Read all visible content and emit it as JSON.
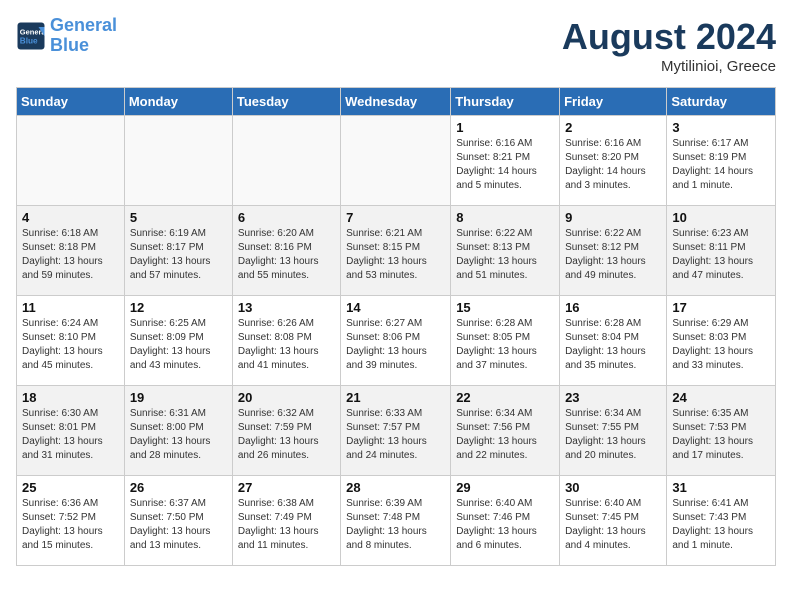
{
  "logo": {
    "line1": "General",
    "line2": "Blue"
  },
  "title": "August 2024",
  "subtitle": "Mytilinioi, Greece",
  "weekdays": [
    "Sunday",
    "Monday",
    "Tuesday",
    "Wednesday",
    "Thursday",
    "Friday",
    "Saturday"
  ],
  "weeks": [
    [
      {
        "day": "",
        "info": ""
      },
      {
        "day": "",
        "info": ""
      },
      {
        "day": "",
        "info": ""
      },
      {
        "day": "",
        "info": ""
      },
      {
        "day": "1",
        "info": "Sunrise: 6:16 AM\nSunset: 8:21 PM\nDaylight: 14 hours\nand 5 minutes."
      },
      {
        "day": "2",
        "info": "Sunrise: 6:16 AM\nSunset: 8:20 PM\nDaylight: 14 hours\nand 3 minutes."
      },
      {
        "day": "3",
        "info": "Sunrise: 6:17 AM\nSunset: 8:19 PM\nDaylight: 14 hours\nand 1 minute."
      }
    ],
    [
      {
        "day": "4",
        "info": "Sunrise: 6:18 AM\nSunset: 8:18 PM\nDaylight: 13 hours\nand 59 minutes."
      },
      {
        "day": "5",
        "info": "Sunrise: 6:19 AM\nSunset: 8:17 PM\nDaylight: 13 hours\nand 57 minutes."
      },
      {
        "day": "6",
        "info": "Sunrise: 6:20 AM\nSunset: 8:16 PM\nDaylight: 13 hours\nand 55 minutes."
      },
      {
        "day": "7",
        "info": "Sunrise: 6:21 AM\nSunset: 8:15 PM\nDaylight: 13 hours\nand 53 minutes."
      },
      {
        "day": "8",
        "info": "Sunrise: 6:22 AM\nSunset: 8:13 PM\nDaylight: 13 hours\nand 51 minutes."
      },
      {
        "day": "9",
        "info": "Sunrise: 6:22 AM\nSunset: 8:12 PM\nDaylight: 13 hours\nand 49 minutes."
      },
      {
        "day": "10",
        "info": "Sunrise: 6:23 AM\nSunset: 8:11 PM\nDaylight: 13 hours\nand 47 minutes."
      }
    ],
    [
      {
        "day": "11",
        "info": "Sunrise: 6:24 AM\nSunset: 8:10 PM\nDaylight: 13 hours\nand 45 minutes."
      },
      {
        "day": "12",
        "info": "Sunrise: 6:25 AM\nSunset: 8:09 PM\nDaylight: 13 hours\nand 43 minutes."
      },
      {
        "day": "13",
        "info": "Sunrise: 6:26 AM\nSunset: 8:08 PM\nDaylight: 13 hours\nand 41 minutes."
      },
      {
        "day": "14",
        "info": "Sunrise: 6:27 AM\nSunset: 8:06 PM\nDaylight: 13 hours\nand 39 minutes."
      },
      {
        "day": "15",
        "info": "Sunrise: 6:28 AM\nSunset: 8:05 PM\nDaylight: 13 hours\nand 37 minutes."
      },
      {
        "day": "16",
        "info": "Sunrise: 6:28 AM\nSunset: 8:04 PM\nDaylight: 13 hours\nand 35 minutes."
      },
      {
        "day": "17",
        "info": "Sunrise: 6:29 AM\nSunset: 8:03 PM\nDaylight: 13 hours\nand 33 minutes."
      }
    ],
    [
      {
        "day": "18",
        "info": "Sunrise: 6:30 AM\nSunset: 8:01 PM\nDaylight: 13 hours\nand 31 minutes."
      },
      {
        "day": "19",
        "info": "Sunrise: 6:31 AM\nSunset: 8:00 PM\nDaylight: 13 hours\nand 28 minutes."
      },
      {
        "day": "20",
        "info": "Sunrise: 6:32 AM\nSunset: 7:59 PM\nDaylight: 13 hours\nand 26 minutes."
      },
      {
        "day": "21",
        "info": "Sunrise: 6:33 AM\nSunset: 7:57 PM\nDaylight: 13 hours\nand 24 minutes."
      },
      {
        "day": "22",
        "info": "Sunrise: 6:34 AM\nSunset: 7:56 PM\nDaylight: 13 hours\nand 22 minutes."
      },
      {
        "day": "23",
        "info": "Sunrise: 6:34 AM\nSunset: 7:55 PM\nDaylight: 13 hours\nand 20 minutes."
      },
      {
        "day": "24",
        "info": "Sunrise: 6:35 AM\nSunset: 7:53 PM\nDaylight: 13 hours\nand 17 minutes."
      }
    ],
    [
      {
        "day": "25",
        "info": "Sunrise: 6:36 AM\nSunset: 7:52 PM\nDaylight: 13 hours\nand 15 minutes."
      },
      {
        "day": "26",
        "info": "Sunrise: 6:37 AM\nSunset: 7:50 PM\nDaylight: 13 hours\nand 13 minutes."
      },
      {
        "day": "27",
        "info": "Sunrise: 6:38 AM\nSunset: 7:49 PM\nDaylight: 13 hours\nand 11 minutes."
      },
      {
        "day": "28",
        "info": "Sunrise: 6:39 AM\nSunset: 7:48 PM\nDaylight: 13 hours\nand 8 minutes."
      },
      {
        "day": "29",
        "info": "Sunrise: 6:40 AM\nSunset: 7:46 PM\nDaylight: 13 hours\nand 6 minutes."
      },
      {
        "day": "30",
        "info": "Sunrise: 6:40 AM\nSunset: 7:45 PM\nDaylight: 13 hours\nand 4 minutes."
      },
      {
        "day": "31",
        "info": "Sunrise: 6:41 AM\nSunset: 7:43 PM\nDaylight: 13 hours\nand 1 minute."
      }
    ]
  ]
}
